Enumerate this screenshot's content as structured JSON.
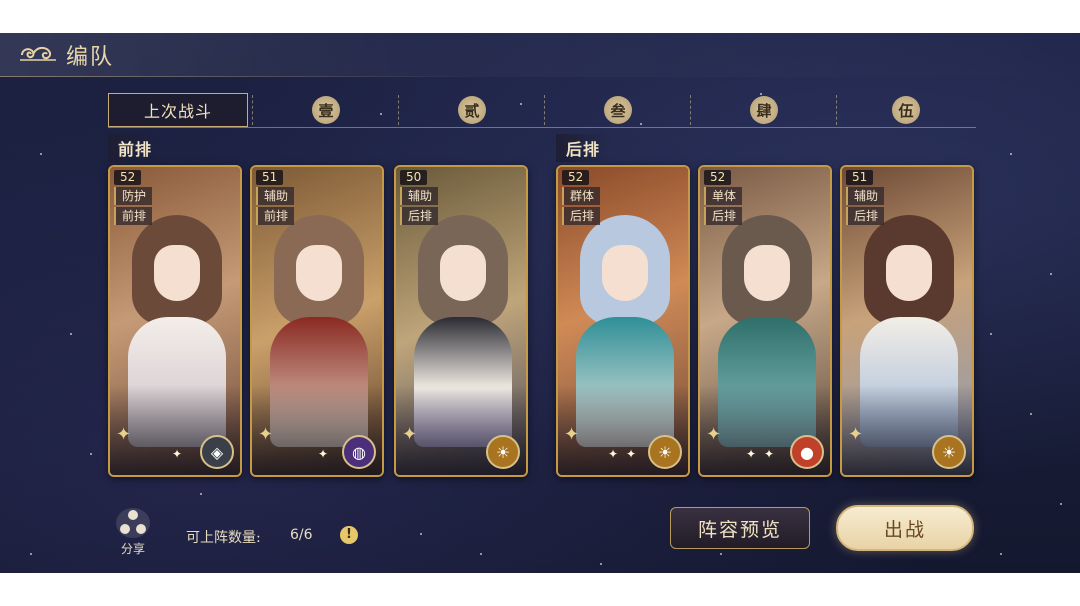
{
  "header": {
    "title": "编队"
  },
  "tabs": [
    {
      "label": "上次战斗",
      "active": true
    },
    {
      "label": "壹"
    },
    {
      "label": "贰"
    },
    {
      "label": "叁"
    },
    {
      "label": "肆"
    },
    {
      "label": "伍"
    }
  ],
  "rows": {
    "front": "前排",
    "back": "后排"
  },
  "cards": [
    {
      "level": "52",
      "tag1": "防护",
      "tag2": "前排",
      "element_icon": "compass-icon",
      "element_color": "#3a3f4a"
    },
    {
      "level": "51",
      "tag1": "辅助",
      "tag2": "前排",
      "element_icon": "planet-icon",
      "element_color": "#4b2f7a"
    },
    {
      "level": "50",
      "tag1": "辅助",
      "tag2": "后排",
      "element_icon": "sun-icon",
      "element_color": "#a8741f"
    },
    {
      "level": "52",
      "tag1": "群体",
      "tag2": "后排",
      "element_icon": "sun-icon",
      "element_color": "#a8741f"
    },
    {
      "level": "52",
      "tag1": "单体",
      "tag2": "后排",
      "element_icon": "fire-orb-icon",
      "element_color": "#c0402a"
    },
    {
      "level": "51",
      "tag1": "辅助",
      "tag2": "后排",
      "element_icon": "sun-icon",
      "element_color": "#a8741f"
    }
  ],
  "bottom": {
    "share_label": "分享",
    "deploy_label": "可上阵数量:",
    "deploy_count": "6/6",
    "info_icon": "!",
    "preview_button": "阵容预览",
    "fight_button": "出战"
  },
  "colors": {
    "accent_gold": "#c69a45",
    "background": "#1a1f3d"
  }
}
